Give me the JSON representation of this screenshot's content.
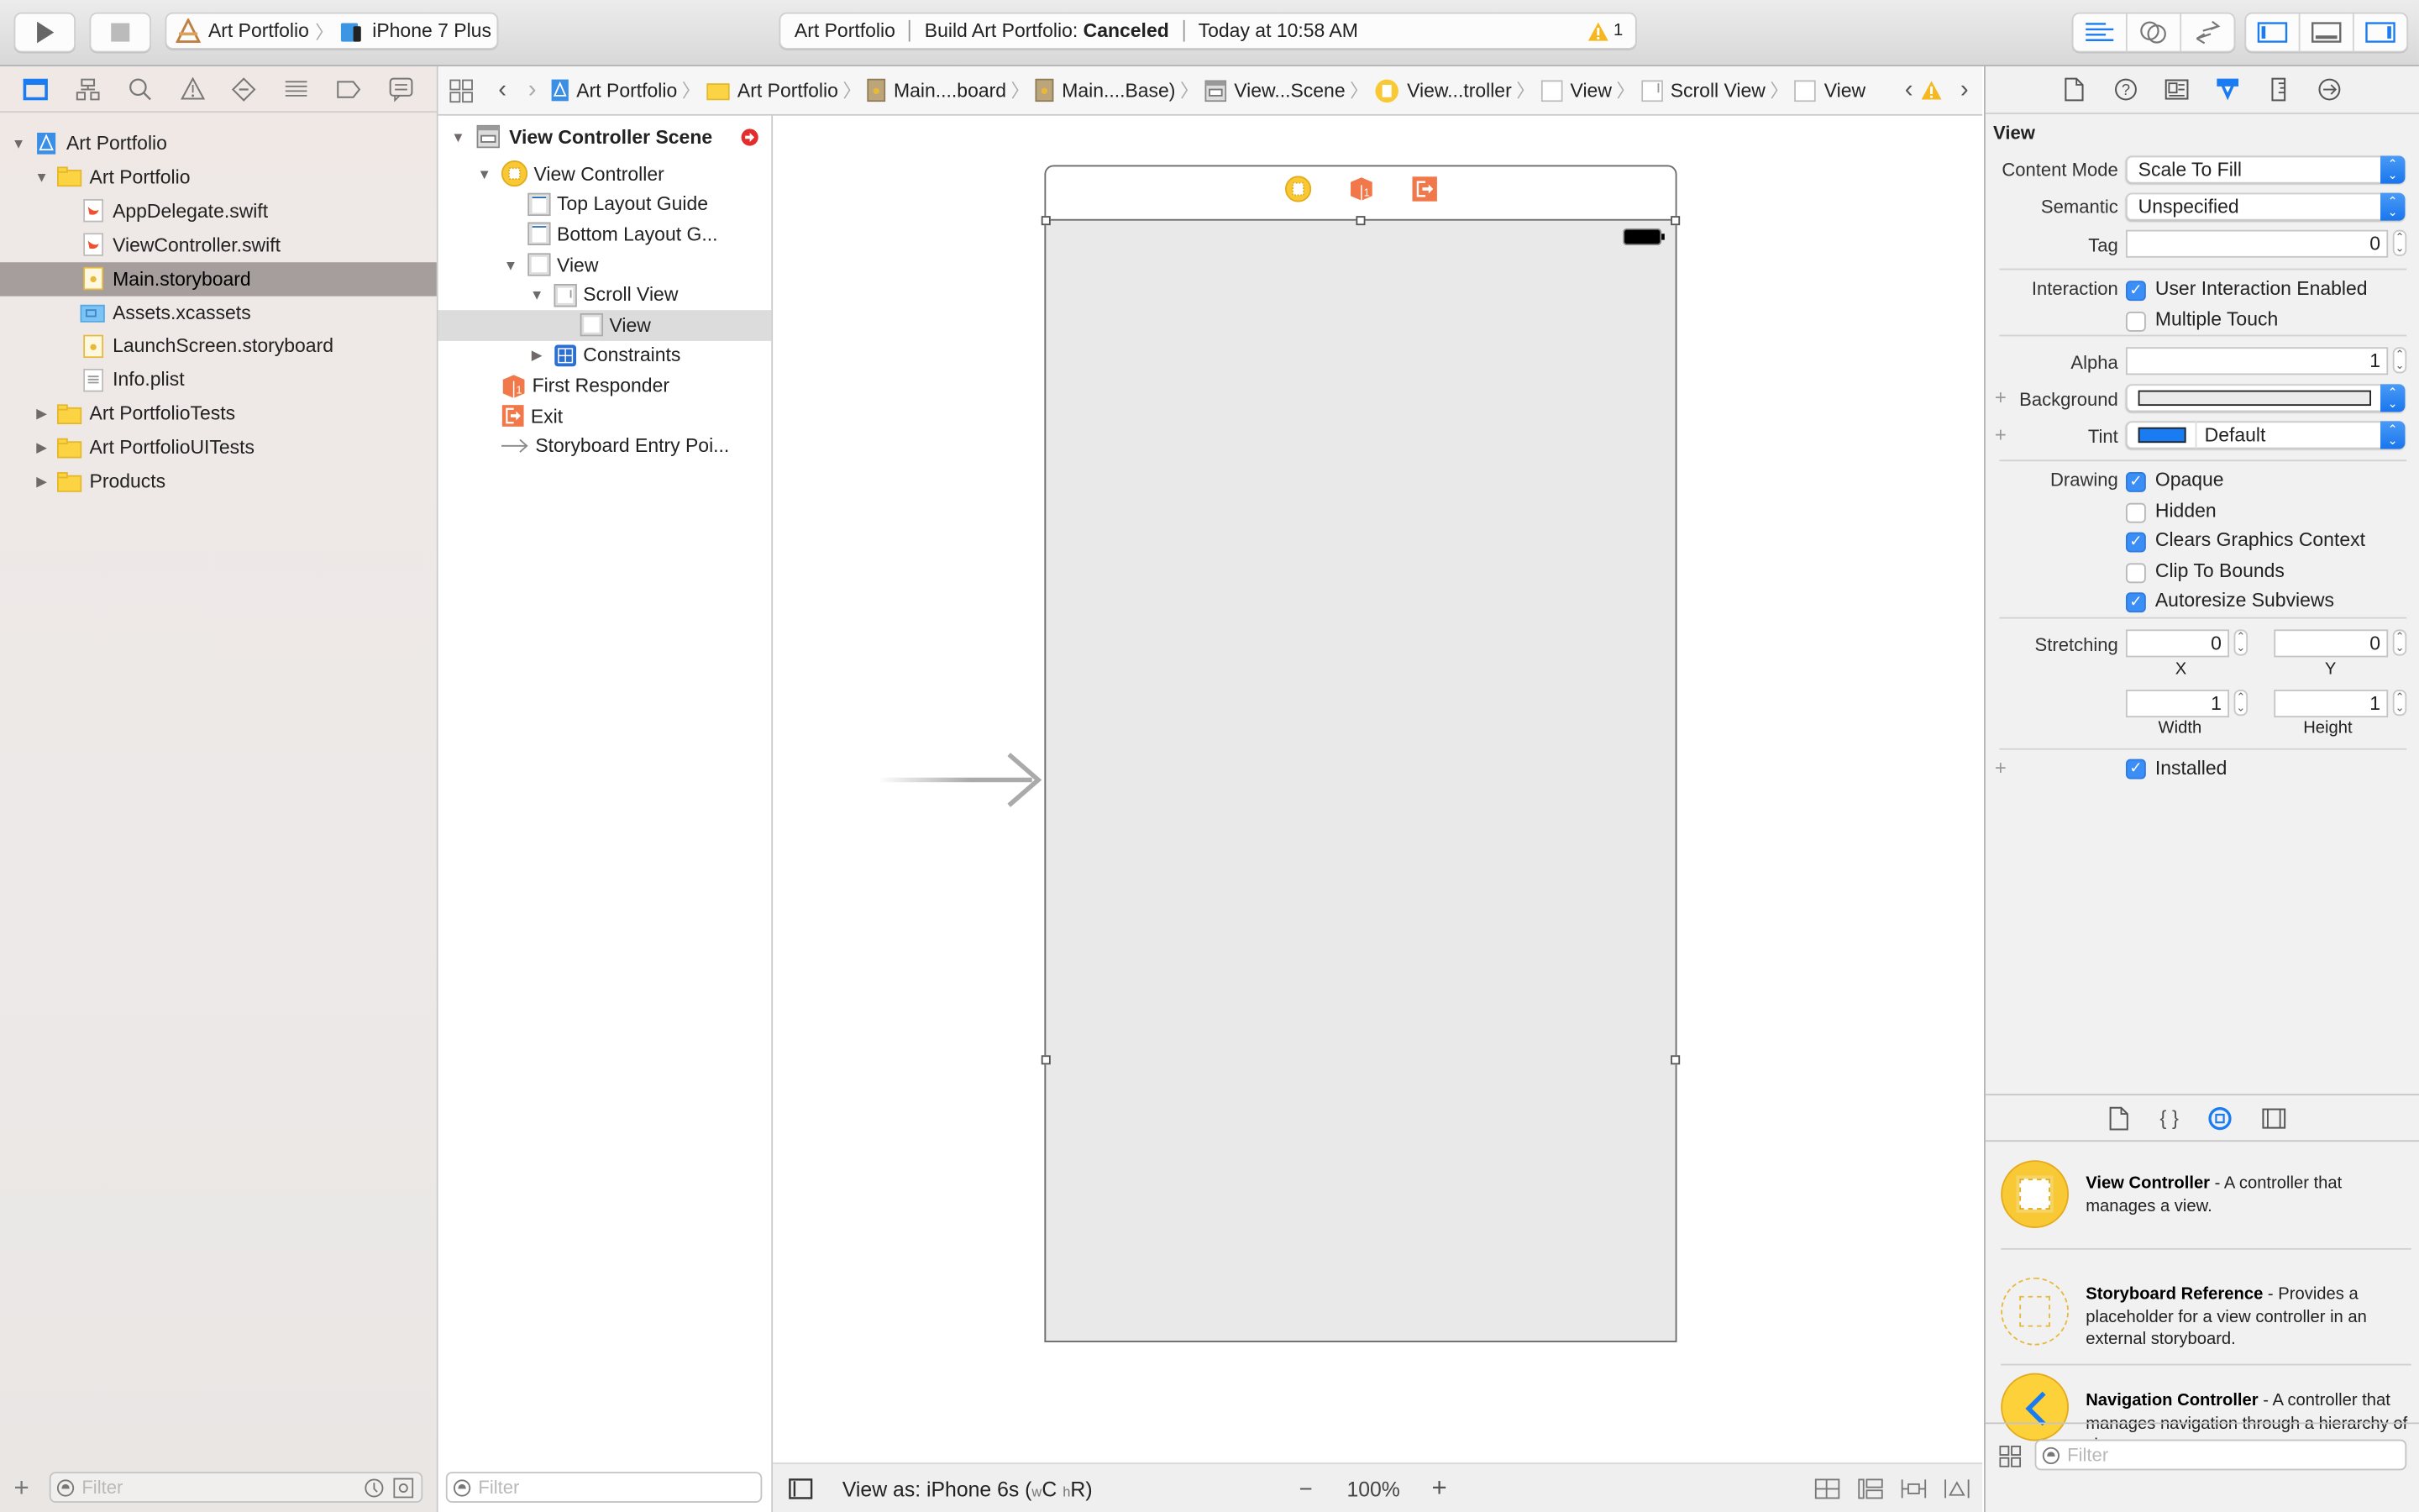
{
  "toolbar": {
    "scheme": {
      "project": "Art Portfolio",
      "device": "iPhone 7 Plus"
    },
    "activity": {
      "project": "Art Portfolio",
      "status_prefix": "Build Art Portfolio:",
      "status": "Canceled",
      "time": "Today at 10:58 AM",
      "warning_count": "1"
    },
    "editor_buttons": [
      "standard-editor",
      "assistant-editor",
      "version-editor"
    ],
    "view_buttons": [
      "toggle-navigator",
      "toggle-debug-area",
      "toggle-utilities"
    ]
  },
  "navigator": {
    "tabs": [
      "project-navigator",
      "symbol-navigator",
      "find-navigator",
      "issue-navigator",
      "test-navigator",
      "debug-navigator",
      "breakpoint-navigator",
      "report-navigator"
    ],
    "tree": [
      {
        "label": "Art Portfolio",
        "type": "project",
        "level": 0,
        "expanded": true
      },
      {
        "label": "Art Portfolio",
        "type": "folder",
        "level": 1,
        "expanded": true
      },
      {
        "label": "AppDelegate.swift",
        "type": "swift",
        "level": 2
      },
      {
        "label": "ViewController.swift",
        "type": "swift",
        "level": 2
      },
      {
        "label": "Main.storyboard",
        "type": "storyboard",
        "level": 2,
        "selected": true
      },
      {
        "label": "Assets.xcassets",
        "type": "assets",
        "level": 2
      },
      {
        "label": "LaunchScreen.storyboard",
        "type": "storyboard",
        "level": 2
      },
      {
        "label": "Info.plist",
        "type": "plist",
        "level": 2
      },
      {
        "label": "Art PortfolioTests",
        "type": "folder",
        "level": 1,
        "expanded": false
      },
      {
        "label": "Art PortfolioUITests",
        "type": "folder",
        "level": 1,
        "expanded": false
      },
      {
        "label": "Products",
        "type": "folder",
        "level": 1,
        "expanded": false
      }
    ],
    "filter_placeholder": "Filter"
  },
  "jumpbar": {
    "crumbs": [
      "Art Portfolio",
      "Art Portfolio",
      "Main....board",
      "Main....Base)",
      "View...Scene",
      "View...troller",
      "View",
      "Scroll View",
      "View"
    ]
  },
  "outline": {
    "scene_title": "View Controller Scene",
    "items": [
      {
        "label": "View Controller",
        "level": 1,
        "expanded": true,
        "icon": "view-controller"
      },
      {
        "label": "Top Layout Guide",
        "level": 2,
        "icon": "layout-guide"
      },
      {
        "label": "Bottom Layout G...",
        "level": 2,
        "icon": "layout-guide"
      },
      {
        "label": "View",
        "level": 2,
        "expanded": true,
        "icon": "view"
      },
      {
        "label": "Scroll View",
        "level": 3,
        "expanded": true,
        "icon": "scroll-view"
      },
      {
        "label": "View",
        "level": 4,
        "icon": "view",
        "selected": true
      },
      {
        "label": "Constraints",
        "level": 3,
        "expanded": false,
        "icon": "constraints"
      },
      {
        "label": "First Responder",
        "level": 1,
        "icon": "first-responder"
      },
      {
        "label": "Exit",
        "level": 1,
        "icon": "exit"
      },
      {
        "label": "Storyboard Entry Poi...",
        "level": 1,
        "icon": "entry-arrow"
      }
    ],
    "filter_placeholder": "Filter"
  },
  "canvas": {
    "view_as_prefix": "View as: iPhone 6s (",
    "size_w": "w",
    "size_w_val": "C",
    "size_h": "h",
    "size_h_val": "R)",
    "zoom": "100%",
    "zoom_out": "−",
    "zoom_in": "+"
  },
  "inspector": {
    "section_title": "View",
    "content_mode": {
      "label": "Content Mode",
      "value": "Scale To Fill"
    },
    "semantic": {
      "label": "Semantic",
      "value": "Unspecified"
    },
    "tag": {
      "label": "Tag",
      "value": "0"
    },
    "interaction": {
      "label": "Interaction",
      "options": [
        {
          "label": "User Interaction Enabled",
          "checked": true
        },
        {
          "label": "Multiple Touch",
          "checked": false
        }
      ]
    },
    "alpha": {
      "label": "Alpha",
      "value": "1"
    },
    "background": {
      "label": "Background",
      "color": "#ebebeb"
    },
    "tint": {
      "label": "Tint",
      "value": "Default",
      "color": "#1a7cf2"
    },
    "drawing": {
      "label": "Drawing",
      "options": [
        {
          "label": "Opaque",
          "checked": true
        },
        {
          "label": "Hidden",
          "checked": false
        },
        {
          "label": "Clears Graphics Context",
          "checked": true
        },
        {
          "label": "Clip To Bounds",
          "checked": false
        },
        {
          "label": "Autoresize Subviews",
          "checked": true
        }
      ]
    },
    "stretching": {
      "label": "Stretching",
      "x": "0",
      "y": "0",
      "width": "1",
      "height": "1",
      "x_label": "X",
      "y_label": "Y",
      "width_label": "Width",
      "height_label": "Height"
    },
    "installed": {
      "label": "Installed",
      "checked": true
    }
  },
  "library": {
    "tabs": [
      "file-templates",
      "code-snippets",
      "object-library",
      "media-library"
    ],
    "items": [
      {
        "name": "View Controller",
        "desc": " - A controller that manages a view."
      },
      {
        "name": "Storyboard Reference",
        "desc": " - Provides a placeholder for a view controller in an external storyboard."
      },
      {
        "name": "Navigation Controller",
        "desc": " - A controller that manages navigation through a hierarchy of views."
      }
    ],
    "filter_placeholder": "Filter"
  },
  "colors": {
    "accent": "#1a7cf2",
    "selection": "#a69e9d",
    "warning": "#f5b820",
    "object_orange": "#f0784a",
    "vc_yellow": "#f9c935"
  }
}
